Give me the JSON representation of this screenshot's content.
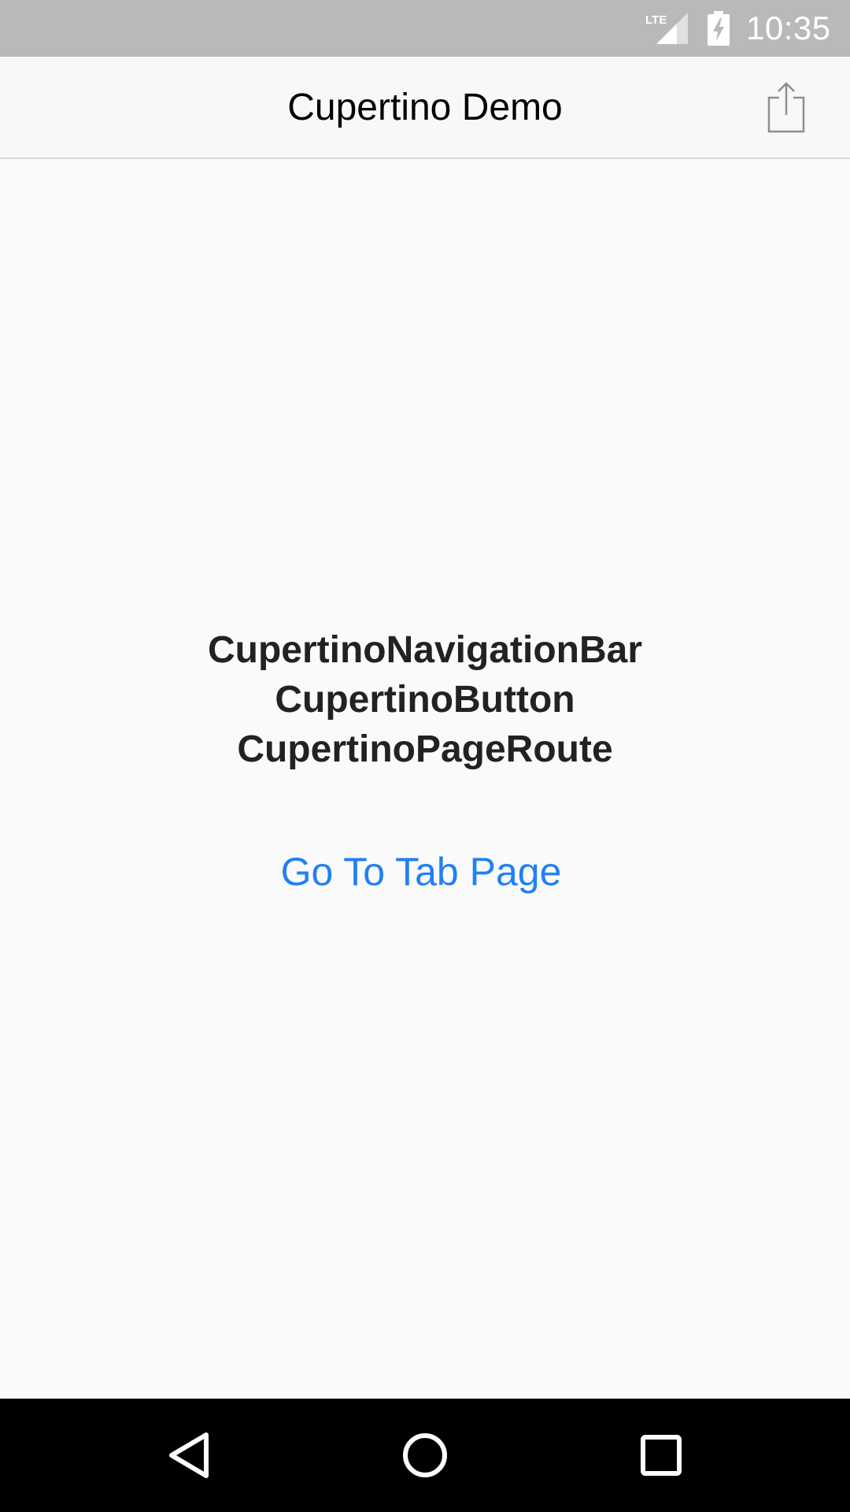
{
  "status_bar": {
    "network_label": "LTE",
    "time": "10:35",
    "icons": [
      "lte-signal-icon",
      "battery-charging-icon"
    ]
  },
  "nav_bar": {
    "title": "Cupertino Demo",
    "trailing_icon": "share-icon"
  },
  "main": {
    "widget_lines": [
      "CupertinoNavigationBar",
      "CupertinoButton",
      "CupertinoPageRoute"
    ],
    "tab_page_button_label": "Go To Tab Page"
  },
  "system_nav": {
    "icons": [
      "back-icon",
      "home-icon",
      "recents-icon"
    ]
  },
  "colors": {
    "status_bar_bg": "#b9b9b9",
    "nav_bar_bg": "#f8f8f8",
    "page_bg": "#fafafa",
    "accent": "#2180f3",
    "system_nav_bg": "#000000"
  }
}
